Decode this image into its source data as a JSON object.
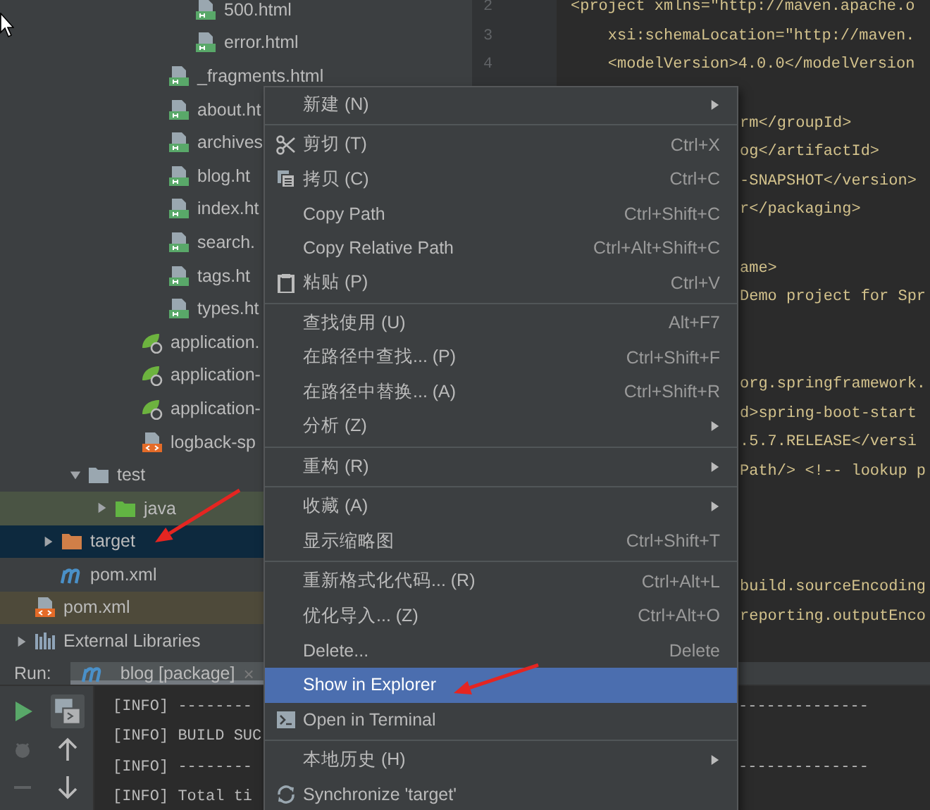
{
  "project_tree": {
    "items": [
      {
        "children": [
          {
            "children": [
              {
                "children": [
                  {
                    "children": [
                      {
                        "children": [
                          {
                            "children": [
                              {
                                "label": "500.html",
                                "kind": "html-file",
                                "selected": false
                              },
                              {
                                "label": "error.html",
                                "kind": "html-file",
                                "selected": false
                              }
                            ]
                          },
                          {
                            "label": "_fragments.html",
                            "kind": "html-file",
                            "selected": false
                          },
                          {
                            "label": "about.ht",
                            "kind": "html-file",
                            "selected": false
                          },
                          {
                            "label": "archives",
                            "kind": "html-file",
                            "selected": false
                          },
                          {
                            "label": "blog.ht",
                            "kind": "html-file",
                            "selected": false
                          },
                          {
                            "label": "index.ht",
                            "kind": "html-file",
                            "selected": false
                          },
                          {
                            "label": "search.",
                            "kind": "html-file",
                            "selected": false
                          },
                          {
                            "label": "tags.ht",
                            "kind": "html-file",
                            "selected": false
                          },
                          {
                            "label": "types.ht",
                            "kind": "html-file",
                            "selected": false
                          }
                        ]
                      },
                      {
                        "label": "application.",
                        "kind": "spring-config",
                        "selected": false
                      },
                      {
                        "label": "application-",
                        "kind": "spring-config",
                        "selected": false
                      },
                      {
                        "label": "application-",
                        "kind": "spring-config",
                        "selected": false
                      },
                      {
                        "label": "logback-sp",
                        "kind": "xml-file",
                        "selected": false
                      }
                    ]
                  }
                ]
              },
              {
                "label": "test",
                "kind": "folder",
                "expanded": true,
                "selected": false,
                "children": [
                  {
                    "label": "java",
                    "kind": "test-folder",
                    "expanded": false,
                    "selected": false,
                    "color": "#4a5444"
                  }
                ]
              }
            ]
          },
          {
            "label": "target",
            "kind": "excluded-folder",
            "expanded": false,
            "selected": true
          },
          {
            "label": "pom.xml",
            "kind": "maven-file",
            "selected": false
          }
        ]
      },
      {
        "label": "pom.xml",
        "kind": "xml-file",
        "selected": false,
        "color": "#4e4a3a"
      },
      {
        "label": "External Libraries",
        "kind": "libraries",
        "expanded": false,
        "selected": false
      }
    ]
  },
  "editor": {
    "lines": [
      {
        "kind": "full",
        "number": "2",
        "code": "<project xmlns=\"http://maven.apache.o"
      },
      {
        "kind": "full",
        "number": "3",
        "code": "    xsi:schemaLocation=\"http://maven."
      },
      {
        "kind": "full",
        "number": "4",
        "code": "    <modelVersion>4.0.0</modelVersion"
      },
      {
        "kind": "blank"
      },
      {
        "kind": "clipped",
        "code": "rm</groupId>"
      },
      {
        "kind": "clipped",
        "code": "og</artifactId>"
      },
      {
        "kind": "clipped",
        "code": "-SNAPSHOT</version>"
      },
      {
        "kind": "clipped",
        "code": "r</packaging>"
      },
      {
        "kind": "blank"
      },
      {
        "kind": "clipped",
        "code": "ame>"
      },
      {
        "kind": "clipped",
        "code": "Demo project for Spr"
      },
      {
        "kind": "blank"
      },
      {
        "kind": "blank"
      },
      {
        "kind": "clipped",
        "code": "org.springframework."
      },
      {
        "kind": "clipped",
        "code": "d>spring-boot-start"
      },
      {
        "kind": "clipped",
        "code": ".5.7.RELEASE</versi"
      },
      {
        "kind": "clipped",
        "code": "Path/> <!-- lookup p"
      },
      {
        "kind": "blank"
      },
      {
        "kind": "blank"
      },
      {
        "kind": "blank"
      },
      {
        "kind": "clipped",
        "code": "build.sourceEncoding"
      },
      {
        "kind": "clipped",
        "code": "reporting.outputEnco"
      }
    ]
  },
  "context_menu": {
    "items": [
      {
        "kind": "submenu",
        "label": "新建 (N)",
        "selected": false
      },
      {
        "kind": "separator"
      },
      {
        "kind": "item",
        "label": "剪切 (T)",
        "shortcut": "Ctrl+X",
        "selected": false
      },
      {
        "kind": "item",
        "label": "拷贝 (C)",
        "shortcut": "Ctrl+C",
        "selected": false
      },
      {
        "kind": "item",
        "label": "Copy Path",
        "shortcut": "Ctrl+Shift+C",
        "selected": false
      },
      {
        "kind": "item",
        "label": "Copy Relative Path",
        "shortcut": "Ctrl+Alt+Shift+C",
        "selected": false
      },
      {
        "kind": "item",
        "label": "粘贴 (P)",
        "shortcut": "Ctrl+V",
        "selected": false
      },
      {
        "kind": "separator"
      },
      {
        "kind": "item",
        "label": "查找使用 (U)",
        "shortcut": "Alt+F7",
        "selected": false
      },
      {
        "kind": "item",
        "label": "在路径中查找... (P)",
        "shortcut": "Ctrl+Shift+F",
        "selected": false
      },
      {
        "kind": "item",
        "label": "在路径中替换... (A)",
        "shortcut": "Ctrl+Shift+R",
        "selected": false
      },
      {
        "kind": "submenu",
        "label": "分析 (Z)",
        "selected": false
      },
      {
        "kind": "separator"
      },
      {
        "kind": "submenu",
        "label": "重构 (R)",
        "selected": false
      },
      {
        "kind": "separator"
      },
      {
        "kind": "submenu",
        "label": "收藏 (A)",
        "selected": false
      },
      {
        "kind": "item",
        "label": "显示缩略图",
        "shortcut": "Ctrl+Shift+T",
        "selected": false
      },
      {
        "kind": "separator"
      },
      {
        "kind": "item",
        "label": "重新格式化代码... (R)",
        "shortcut": "Ctrl+Alt+L",
        "selected": false
      },
      {
        "kind": "item",
        "label": "优化导入... (Z)",
        "shortcut": "Ctrl+Alt+O",
        "selected": false
      },
      {
        "kind": "item",
        "label": "Delete...",
        "shortcut": "Delete",
        "selected": false
      },
      {
        "kind": "item",
        "label": "Show in Explorer",
        "selected": true
      },
      {
        "kind": "item",
        "label": "Open in Terminal",
        "selected": false
      },
      {
        "kind": "separator"
      },
      {
        "kind": "submenu",
        "label": "本地历史 (H)",
        "selected": false
      },
      {
        "kind": "item",
        "label": "Synchronize 'target'",
        "selected": false
      }
    ]
  },
  "run_panel": {
    "label": "Run:",
    "tab": {
      "title": "blog [package]",
      "close": "×",
      "selected": true
    },
    "console": {
      "lines": [
        {
          "text": "[INFO] --------",
          "tail": "--------------"
        },
        {
          "text": "[INFO] BUILD SUC"
        },
        {
          "text": "[INFO] --------",
          "tail": "--------------"
        },
        {
          "text": "[INFO] Total ti"
        }
      ]
    }
  },
  "annotations": [
    {
      "kind": "arrow",
      "color": "#e52521"
    },
    {
      "kind": "arrow",
      "color": "#e52521"
    }
  ]
}
